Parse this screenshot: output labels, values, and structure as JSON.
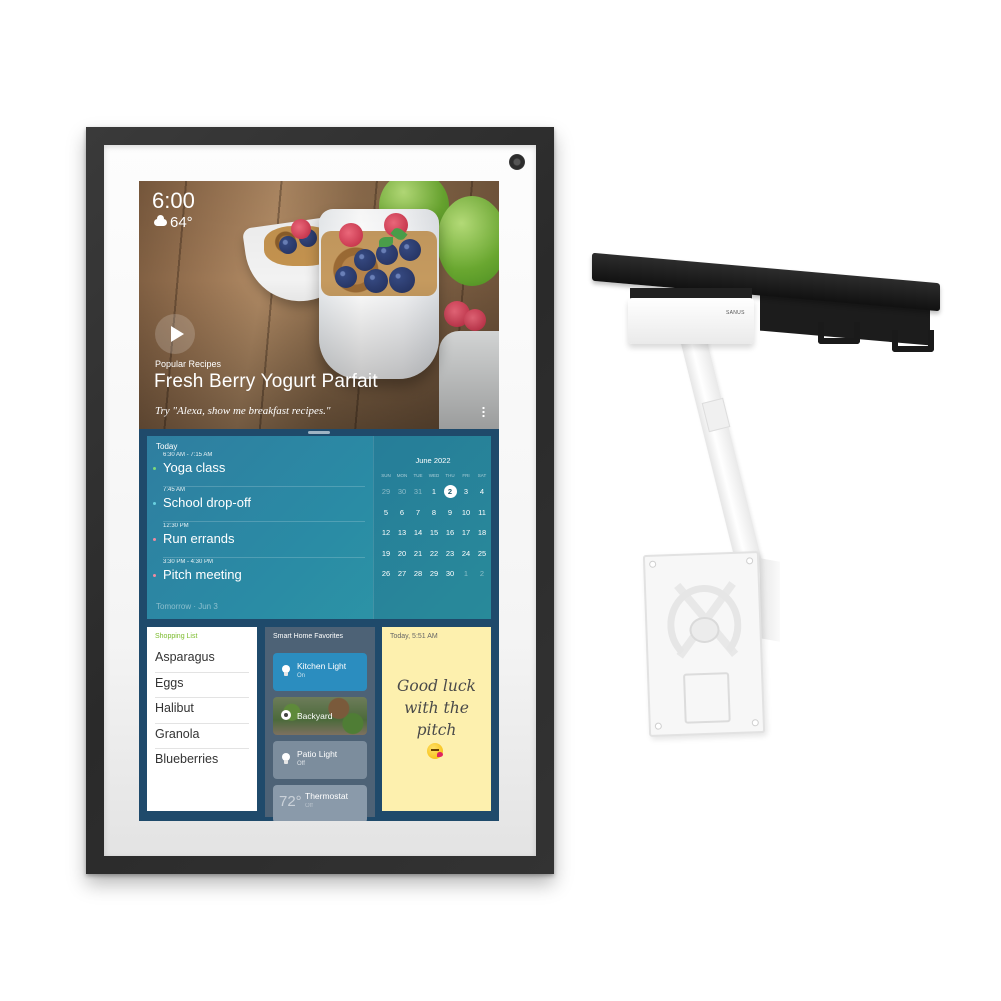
{
  "device": {
    "name": "Echo Show 15 with wall mount"
  },
  "hero": {
    "time": "6:00",
    "weather_icon": "cloud-icon",
    "temperature": "64°",
    "category": "Popular Recipes",
    "title": "Fresh Berry Yogurt Parfait",
    "hint": "Try \"Alexa, show me breakfast recipes.\""
  },
  "agenda": {
    "heading": "Today",
    "events": [
      {
        "time": "6:30 AM - 7:15 AM",
        "name": "Yoga class",
        "color": "#7dd87a"
      },
      {
        "time": "7:45 AM",
        "name": "School drop-off",
        "color": "#6ad0e0"
      },
      {
        "time": "12:30 PM",
        "name": "Run errands",
        "color": "#f08aa0"
      },
      {
        "time": "3:30 PM - 4:30 PM",
        "name": "Pitch meeting",
        "color": "#f08aa0"
      }
    ],
    "tomorrow": "Tomorrow · Jun 3"
  },
  "calendar": {
    "month": "June 2022",
    "weekdays": [
      "SUN",
      "MON",
      "TUE",
      "WED",
      "THU",
      "FRI",
      "SAT"
    ],
    "weeks": [
      [
        {
          "d": "29",
          "m": true
        },
        {
          "d": "30",
          "m": true
        },
        {
          "d": "31",
          "m": true
        },
        {
          "d": "1"
        },
        {
          "d": "2",
          "sel": true
        },
        {
          "d": "3"
        },
        {
          "d": "4"
        }
      ],
      [
        {
          "d": "5"
        },
        {
          "d": "6"
        },
        {
          "d": "7"
        },
        {
          "d": "8"
        },
        {
          "d": "9"
        },
        {
          "d": "10"
        },
        {
          "d": "11"
        }
      ],
      [
        {
          "d": "12"
        },
        {
          "d": "13"
        },
        {
          "d": "14"
        },
        {
          "d": "15"
        },
        {
          "d": "16"
        },
        {
          "d": "17"
        },
        {
          "d": "18"
        }
      ],
      [
        {
          "d": "19"
        },
        {
          "d": "20"
        },
        {
          "d": "21"
        },
        {
          "d": "22"
        },
        {
          "d": "23"
        },
        {
          "d": "24"
        },
        {
          "d": "25"
        }
      ],
      [
        {
          "d": "26"
        },
        {
          "d": "27"
        },
        {
          "d": "28"
        },
        {
          "d": "29"
        },
        {
          "d": "30"
        },
        {
          "d": "1",
          "m": true
        },
        {
          "d": "2",
          "m": true
        }
      ]
    ]
  },
  "shopping": {
    "title": "Shopping List",
    "items": [
      "Asparagus",
      "Eggs",
      "Halibut",
      "Granola",
      "Blueberries"
    ]
  },
  "smart_home": {
    "title": "Smart Home Favorites",
    "devices": [
      {
        "name": "Kitchen Light",
        "status": "On",
        "icon": "bulb-icon"
      },
      {
        "name": "Backyard",
        "status": "",
        "icon": "camera-icon"
      },
      {
        "name": "Patio Light",
        "status": "Off",
        "icon": "bulb-icon"
      },
      {
        "name": "Thermostat",
        "status": "Off",
        "reading": "72°"
      }
    ]
  },
  "note": {
    "timestamp": "Today, 5:51 AM",
    "text": "Good luck with the pitch",
    "emoji": "kissing-face-icon"
  },
  "mount": {
    "brand": "SANUS"
  },
  "colors": {
    "frame": "#2e2e2e",
    "agenda": "#2b8aa5",
    "smart_home_bg": "#4d6276",
    "kitchen_on": "#2b8dbf",
    "note_bg": "#fdf0ae",
    "shopping_title": "#7bbb2c"
  }
}
